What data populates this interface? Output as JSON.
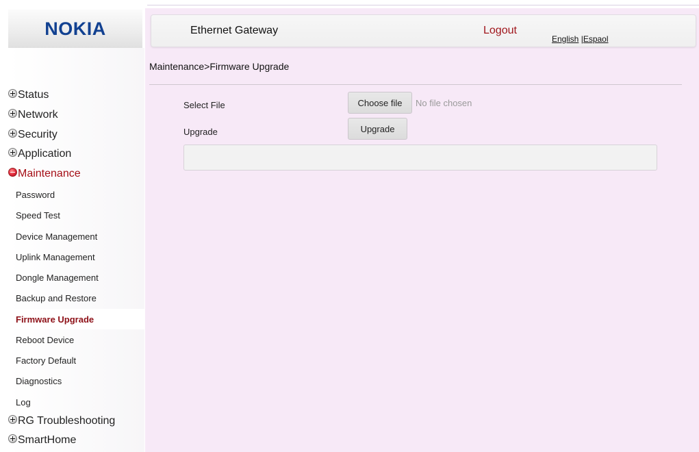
{
  "brand": {
    "logo": "NOKIA",
    "logo_color": "#124191"
  },
  "header": {
    "title": "Ethernet Gateway",
    "logout": "Logout",
    "lang_english": "English",
    "lang_separator": " |",
    "lang_spanish": "Espaol"
  },
  "breadcrumb": "Maintenance>Firmware Upgrade",
  "sidebar": {
    "groups_before": [
      {
        "label": "Status",
        "icon": "plus-icon"
      },
      {
        "label": "Network",
        "icon": "plus-icon"
      },
      {
        "label": "Security",
        "icon": "plus-icon"
      },
      {
        "label": "Application",
        "icon": "plus-icon"
      }
    ],
    "open_group": {
      "label": "Maintenance",
      "icon": "minus-icon"
    },
    "sub_items": [
      {
        "label": "Password"
      },
      {
        "label": "Speed Test"
      },
      {
        "label": "Device Management"
      },
      {
        "label": "Uplink Management"
      },
      {
        "label": "Dongle Management"
      },
      {
        "label": "Backup and Restore"
      },
      {
        "label": "Firmware Upgrade",
        "active": true
      },
      {
        "label": "Reboot Device"
      },
      {
        "label": "Factory Default"
      },
      {
        "label": "Diagnostics"
      },
      {
        "label": "Log"
      }
    ],
    "groups_after": [
      {
        "label": "RG Troubleshooting",
        "icon": "plus-icon"
      },
      {
        "label": "SmartHome",
        "icon": "plus-icon"
      }
    ]
  },
  "form": {
    "select_file_label": "Select File",
    "choose_file_button": "Choose file",
    "no_file_text": "No file chosen",
    "upgrade_label": "Upgrade",
    "upgrade_button": "Upgrade",
    "message": ""
  },
  "colors": {
    "content_bg": "#f7e9f7",
    "accent_red": "#a0161c",
    "active_item": "#8d1017"
  }
}
